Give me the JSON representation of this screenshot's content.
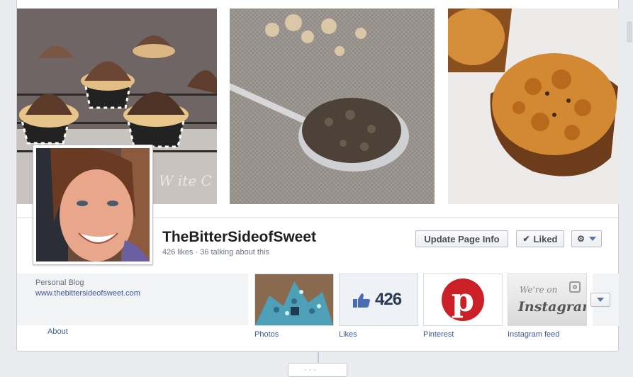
{
  "page": {
    "name": "TheBitterSideofSweet",
    "stats": "426 likes · 36 talking about this"
  },
  "actions": {
    "update_page_info": "Update Page Info",
    "liked": "Liked",
    "check_icon": "✔"
  },
  "about": {
    "category": "Personal Blog",
    "website": "www.thebittersideofsweet.com",
    "link": "About"
  },
  "cover_watermark": "W ite C",
  "apps": [
    {
      "label": "Photos"
    },
    {
      "label": "Likes",
      "count": "426"
    },
    {
      "label": "Pinterest"
    },
    {
      "label": "Instagram feed",
      "badge_top": "We're on",
      "badge_word": "Instagram"
    }
  ],
  "timeline_pill": "· · ·",
  "colors": {
    "link": "#3b5998",
    "pinterest_red": "#cb2027",
    "background": "#e9ebee"
  },
  "icons": [
    "gear-icon",
    "chevron-down-icon",
    "thumbs-up-icon",
    "pinterest-logo-icon",
    "instagram-camera-icon",
    "check-icon"
  ]
}
